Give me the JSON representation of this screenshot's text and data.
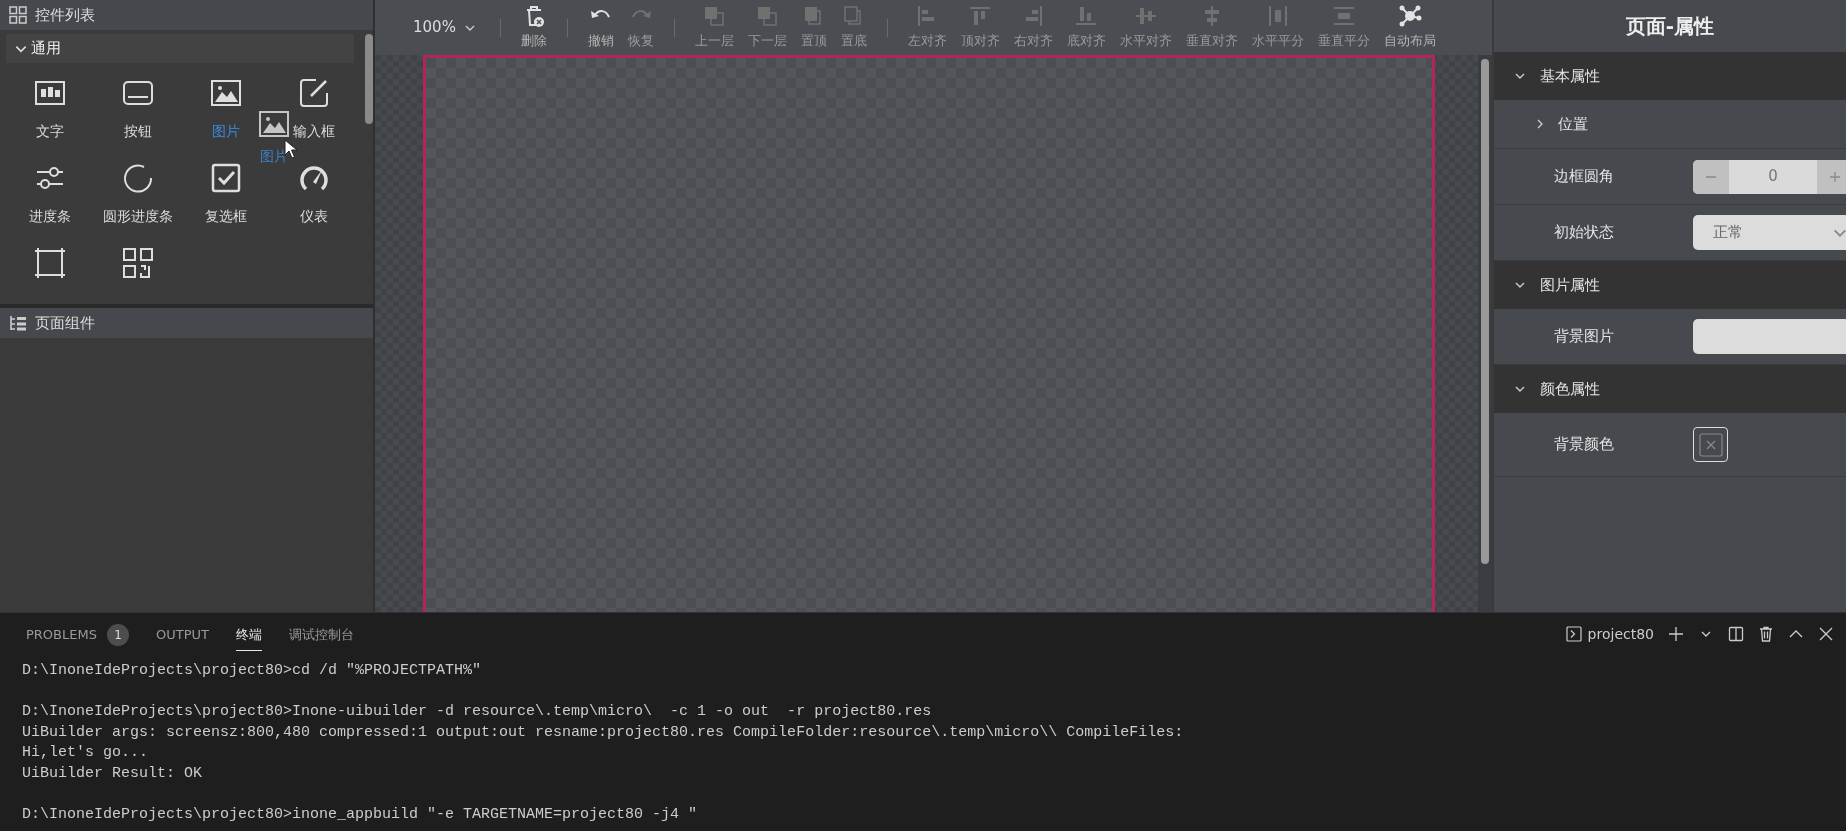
{
  "controls_panel": {
    "title": "控件列表",
    "section": {
      "title": "通用",
      "expanded": true,
      "items": [
        {
          "label": "文字",
          "kind": "text",
          "selected": false
        },
        {
          "label": "按钮",
          "kind": "button",
          "selected": false
        },
        {
          "label": "图片",
          "kind": "image",
          "selected": true
        },
        {
          "label": "输入框",
          "kind": "input",
          "selected": false
        },
        {
          "label": "进度条",
          "kind": "slider",
          "selected": false
        },
        {
          "label": "圆形进度条",
          "kind": "ring",
          "selected": false
        },
        {
          "label": "复选框",
          "kind": "checkbox",
          "selected": false
        },
        {
          "label": "仪表",
          "kind": "gauge",
          "selected": false
        },
        {
          "kind": "canvas",
          "selected": false
        },
        {
          "kind": "qrcode",
          "selected": false
        }
      ]
    }
  },
  "drag_ghost": {
    "label": "图片",
    "kind": "image"
  },
  "components_panel": {
    "title": "页面组件"
  },
  "toolbar": {
    "zoom": "100%",
    "groups": [
      [
        {
          "label": "删除",
          "kind": "delete",
          "disabled": false
        }
      ],
      [
        {
          "label": "撤销",
          "kind": "undo",
          "disabled": false
        },
        {
          "label": "恢复",
          "kind": "redo",
          "disabled": true
        }
      ],
      [
        {
          "label": "上一层",
          "kind": "layer-up",
          "disabled": true
        },
        {
          "label": "下一层",
          "kind": "layer-down",
          "disabled": true
        },
        {
          "label": "置顶",
          "kind": "to-top",
          "disabled": true
        },
        {
          "label": "置底",
          "kind": "to-bottom",
          "disabled": true
        }
      ],
      [
        {
          "label": "左对齐",
          "kind": "align-left",
          "disabled": true
        },
        {
          "label": "顶对齐",
          "kind": "align-top",
          "disabled": true
        },
        {
          "label": "右对齐",
          "kind": "align-right",
          "disabled": true
        },
        {
          "label": "底对齐",
          "kind": "align-bottom",
          "disabled": true
        },
        {
          "label": "水平对齐",
          "kind": "align-hcenter",
          "disabled": true
        },
        {
          "label": "垂直对齐",
          "kind": "align-vcenter",
          "disabled": true
        },
        {
          "label": "水平平分",
          "kind": "distribute-h",
          "disabled": true
        },
        {
          "label": "垂直平分",
          "kind": "distribute-v",
          "disabled": true
        },
        {
          "label": "自动布局",
          "kind": "auto-layout",
          "disabled": false
        }
      ]
    ]
  },
  "properties": {
    "title": "页面-属性",
    "sections": [
      {
        "title": "基本属性",
        "expanded": true,
        "rows": [
          {
            "kind": "group",
            "label": "位置",
            "expanded": false
          },
          {
            "kind": "stepper",
            "label": "边框圆角",
            "value": "0"
          },
          {
            "kind": "select",
            "label": "初始状态",
            "value": "正常"
          }
        ]
      },
      {
        "title": "图片属性",
        "expanded": true,
        "rows": [
          {
            "kind": "image",
            "label": "背景图片"
          }
        ]
      },
      {
        "title": "颜色属性",
        "expanded": true,
        "rows": [
          {
            "kind": "color",
            "label": "背景颜色"
          }
        ]
      }
    ]
  },
  "bottom_panel": {
    "tabs": [
      {
        "label": "PROBLEMS",
        "badge": "1",
        "selected": false
      },
      {
        "label": "OUTPUT",
        "selected": false
      },
      {
        "label": "终端",
        "selected": true
      },
      {
        "label": "调试控制台",
        "selected": false
      }
    ],
    "terminal_name": "project80",
    "terminal_blocks": [
      [
        "D:\\InoneIdeProjects\\project80>cd /d \"%PROJECTPATH%\""
      ],
      [
        "D:\\InoneIdeProjects\\project80>Inone-uibuilder -d resource\\.temp\\micro\\  -c 1 -o out  -r project80.res",
        "UiBuilder args: screensz:800,480 compressed:1 output:out resname:project80.res CompileFolder:resource\\.temp\\micro\\\\ CompileFiles:",
        "Hi,let's go...",
        "UiBuilder Result: OK"
      ],
      [
        "D:\\InoneIdeProjects\\project80>inone_appbuild \"-e TARGETNAME=project80 -j4 \""
      ]
    ]
  }
}
